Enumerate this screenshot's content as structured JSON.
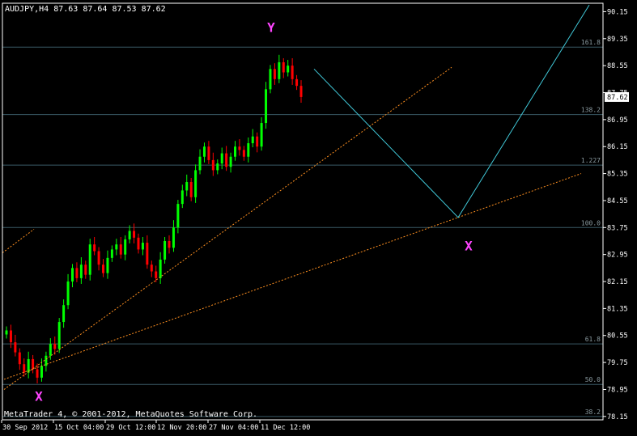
{
  "header": {
    "title": "AUDJPY,H4  87.63 87.64 87.53 87.62"
  },
  "footer": {
    "copyright": "MetaTrader 4, © 2001-2012, MetaQuotes Software Corp."
  },
  "colors": {
    "background": "#000000",
    "axis": "#ffffff",
    "bull_candle": "#00ff00",
    "bear_candle": "#ff0000",
    "level_line": "#3a5a66",
    "projection_line": "#40c8d8",
    "trend_line": "#ff9020",
    "marker": "#ff44ff",
    "price_box_bg": "#ffffff",
    "price_box_fg": "#000000"
  },
  "chart_data": {
    "type": "candlestick",
    "symbol": "AUDJPY",
    "timeframe": "H4",
    "ohlc_last": {
      "open": 87.63,
      "high": 87.64,
      "low": 87.53,
      "close": 87.62
    },
    "current_price": "87.62",
    "ylim": [
      78.05,
      90.4
    ],
    "y_ticks": [
      "90.15",
      "89.35",
      "88.55",
      "87.75",
      "86.95",
      "86.15",
      "85.35",
      "84.55",
      "83.75",
      "82.95",
      "82.15",
      "81.35",
      "80.55",
      "79.75",
      "78.95",
      "78.15"
    ],
    "x_ticks": [
      "30 Sep 2012",
      "15 Oct 04:00",
      "29 Oct 12:00",
      "12 Nov 20:00",
      "27 Nov 04:00",
      "11 Dec 12:00"
    ],
    "levels": [
      {
        "label": "161.8",
        "price": 89.1
      },
      {
        "label": "138.2",
        "price": 87.1
      },
      {
        "label": "1.227",
        "price": 85.6
      },
      {
        "label": "100.0",
        "price": 83.75
      },
      {
        "label": "61.8",
        "price": 80.3
      },
      {
        "label": "50.0",
        "price": 79.1
      },
      {
        "label": "38.2",
        "price": 78.15
      }
    ],
    "markers": [
      {
        "label": "X",
        "price": 79.05
      },
      {
        "label": "Y",
        "price": 89.5
      },
      {
        "label": "X",
        "price": 83.5
      }
    ],
    "series": [
      {
        "values": [
          80.7,
          80.35,
          80.05,
          79.7,
          79.45,
          79.85,
          79.55,
          79.3,
          79.65,
          79.95,
          80.3,
          80.15,
          80.95,
          81.45,
          82.15,
          82.55,
          82.25,
          82.65,
          82.35,
          83.25,
          83.05,
          82.65,
          82.4,
          82.85,
          83.1,
          83.25,
          82.95,
          83.4,
          83.65,
          83.45,
          83.1,
          83.3,
          82.65,
          82.45,
          82.25,
          82.8,
          83.35,
          83.15,
          83.75,
          84.45,
          84.85,
          85.1,
          84.65,
          85.45,
          85.85,
          86.15,
          85.75,
          85.45,
          85.65,
          85.95,
          85.55,
          85.85,
          86.15,
          86.05,
          85.85,
          86.25,
          86.45,
          86.15,
          86.85,
          87.85,
          88.45,
          88.15,
          88.65,
          88.35,
          88.55,
          88.15,
          87.95,
          87.62
        ]
      }
    ],
    "projection": [
      {
        "date": "pt1",
        "price": 88.45
      },
      {
        "date": "pt2",
        "price": 84.05
      },
      {
        "date": "pt3",
        "price": 90.35
      }
    ],
    "trend_lines": [
      {
        "from_price": 78.95,
        "to_price": 88.5
      },
      {
        "from_price": 79.25,
        "to_price": 85.35
      },
      {
        "from_price": 83.0,
        "to_price": 83.7
      }
    ]
  }
}
